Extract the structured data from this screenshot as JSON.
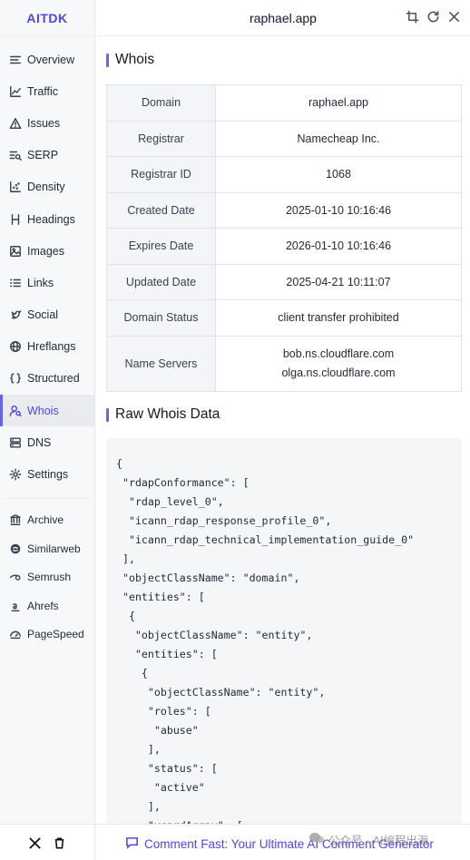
{
  "brand": "AITDK",
  "header": {
    "title": "raphael.app"
  },
  "nav": [
    {
      "label": "Overview",
      "icon": "list-icon"
    },
    {
      "label": "Traffic",
      "icon": "chart-icon"
    },
    {
      "label": "Issues",
      "icon": "warning-icon"
    },
    {
      "label": "SERP",
      "icon": "serp-icon"
    },
    {
      "label": "Density",
      "icon": "density-icon"
    },
    {
      "label": "Headings",
      "icon": "heading-icon"
    },
    {
      "label": "Images",
      "icon": "image-icon"
    },
    {
      "label": "Links",
      "icon": "links-icon"
    },
    {
      "label": "Social",
      "icon": "twitter-icon"
    },
    {
      "label": "Hreflangs",
      "icon": "globe-icon"
    },
    {
      "label": "Structured",
      "icon": "braces-icon"
    },
    {
      "label": "Whois",
      "icon": "user-search-icon",
      "active": true
    },
    {
      "label": "DNS",
      "icon": "server-icon"
    },
    {
      "label": "Settings",
      "icon": "gear-icon"
    }
  ],
  "external": [
    {
      "label": "Archive",
      "icon": "archive-icon"
    },
    {
      "label": "Similarweb",
      "icon": "similarweb-icon"
    },
    {
      "label": "Semrush",
      "icon": "semrush-icon"
    },
    {
      "label": "Ahrefs",
      "icon": "ahrefs-icon"
    },
    {
      "label": "PageSpeed",
      "icon": "pagespeed-icon"
    }
  ],
  "whois": {
    "title": "Whois",
    "rows": [
      {
        "key": "Domain",
        "value": "raphael.app"
      },
      {
        "key": "Registrar",
        "value": "Namecheap Inc."
      },
      {
        "key": "Registrar ID",
        "value": "1068"
      },
      {
        "key": "Created Date",
        "value": "2025-01-10 10:16:46"
      },
      {
        "key": "Expires Date",
        "value": "2026-01-10 10:16:46"
      },
      {
        "key": "Updated Date",
        "value": "2025-04-21 10:11:07"
      },
      {
        "key": "Domain Status",
        "value": "client transfer prohibited"
      },
      {
        "key": "Name Servers",
        "value": [
          "bob.ns.cloudflare.com",
          "olga.ns.cloudflare.com"
        ]
      }
    ]
  },
  "raw": {
    "title": "Raw Whois Data",
    "lines": [
      "{",
      " \"rdapConformance\": [",
      "  \"rdap_level_0\",",
      "  \"icann_rdap_response_profile_0\",",
      "  \"icann_rdap_technical_implementation_guide_0\"",
      " ],",
      " \"objectClassName\": \"domain\",",
      " \"entities\": [",
      "  {",
      "   \"objectClassName\": \"entity\",",
      "   \"entities\": [",
      "    {",
      "     \"objectClassName\": \"entity\",",
      "     \"roles\": [",
      "      \"abuse\"",
      "     ],",
      "     \"status\": [",
      "      \"active\"",
      "     ],",
      "     \"vcardArray\": ["
    ]
  },
  "footer": {
    "promo": "Comment Fast: Your Ultimate AI Comment Generator",
    "watermark": "公众号 · AI编程出海"
  }
}
